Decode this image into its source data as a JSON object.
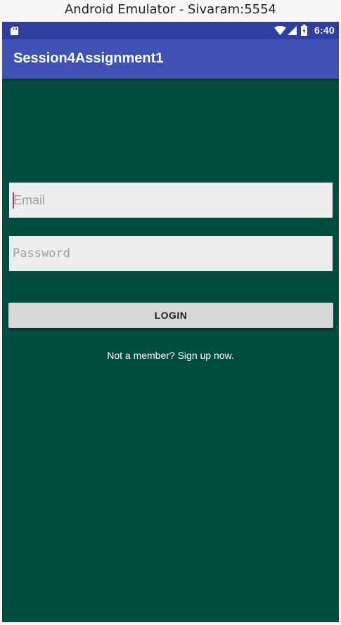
{
  "window": {
    "title": "Android Emulator - Sivaram:5554"
  },
  "status_bar": {
    "time": "6:40",
    "icons": [
      "sd-card-icon",
      "wifi-icon",
      "signal-icon",
      "battery-icon"
    ],
    "color": "#303F9F"
  },
  "app_bar": {
    "title": "Session4Assignment1",
    "color": "#3F51B5"
  },
  "form": {
    "email_placeholder": "Email",
    "email_value": "",
    "password_placeholder": "Password",
    "password_value": "",
    "login_label": "LOGIN",
    "signup_text": "Not a member? Sign up now."
  },
  "colors": {
    "background": "#004D40",
    "input_background": "#EEEEEE",
    "button_background": "#D6D7D7",
    "cursor_accent": "#E91E63"
  }
}
